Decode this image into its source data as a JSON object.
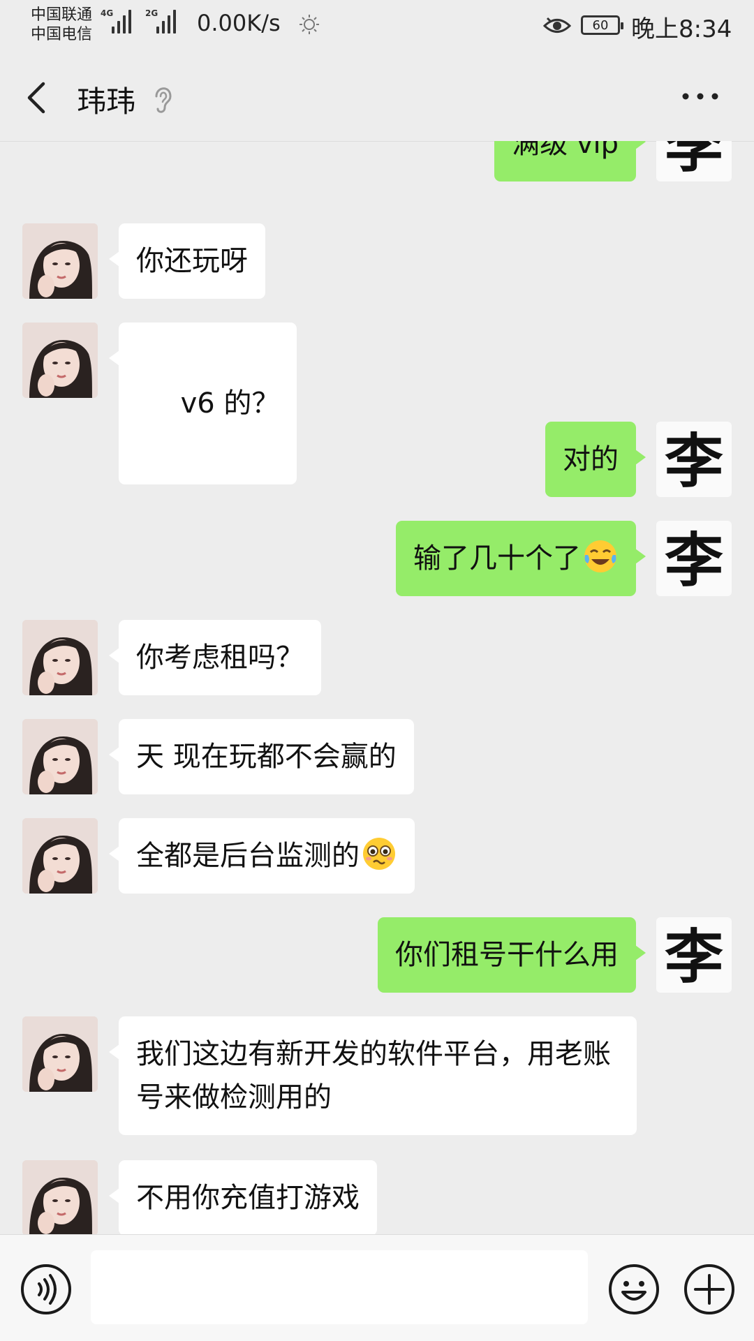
{
  "status_bar": {
    "carrier_1": "中国联通",
    "carrier_2": "中国电信",
    "net_4g": "4G",
    "net_2g": "2G",
    "net_speed": "0.00K/s",
    "battery": "60",
    "time": "晚上8:34"
  },
  "header": {
    "title": "玮玮",
    "back_icon": "chevron-left-icon",
    "mode_icon": "ear-icon",
    "more_icon": "more-icon"
  },
  "messages": [
    {
      "sender": "me",
      "text": "满级 vip"
    },
    {
      "sender": "other",
      "text": "你还玩呀"
    },
    {
      "sender": "other",
      "text": " v6 的？"
    },
    {
      "sender": "me",
      "text": "对的"
    },
    {
      "sender": "me",
      "text": "输了几十个了",
      "emoji": "tears-of-joy-emoji"
    },
    {
      "sender": "other",
      "text": "你考虑租吗？"
    },
    {
      "sender": "other",
      "text": "天 现在玩都不会赢的"
    },
    {
      "sender": "other",
      "text": "全都是后台监测的",
      "emoji": "pleading-face-emoji"
    },
    {
      "sender": "me",
      "text": "你们租号干什么用"
    },
    {
      "sender": "other",
      "text": "我们这边有新开发的软件平台，用老账号来做检测用的"
    },
    {
      "sender": "other",
      "text": "不用你充值打游戏"
    }
  ],
  "my_avatar_glyph": "李",
  "input_bar": {
    "voice_icon": "voice-icon",
    "emoji_icon": "smile-icon",
    "plus_icon": "plus-icon"
  },
  "colors": {
    "background": "#ededed",
    "my_bubble": "#95ec69",
    "other_bubble": "#ffffff"
  }
}
